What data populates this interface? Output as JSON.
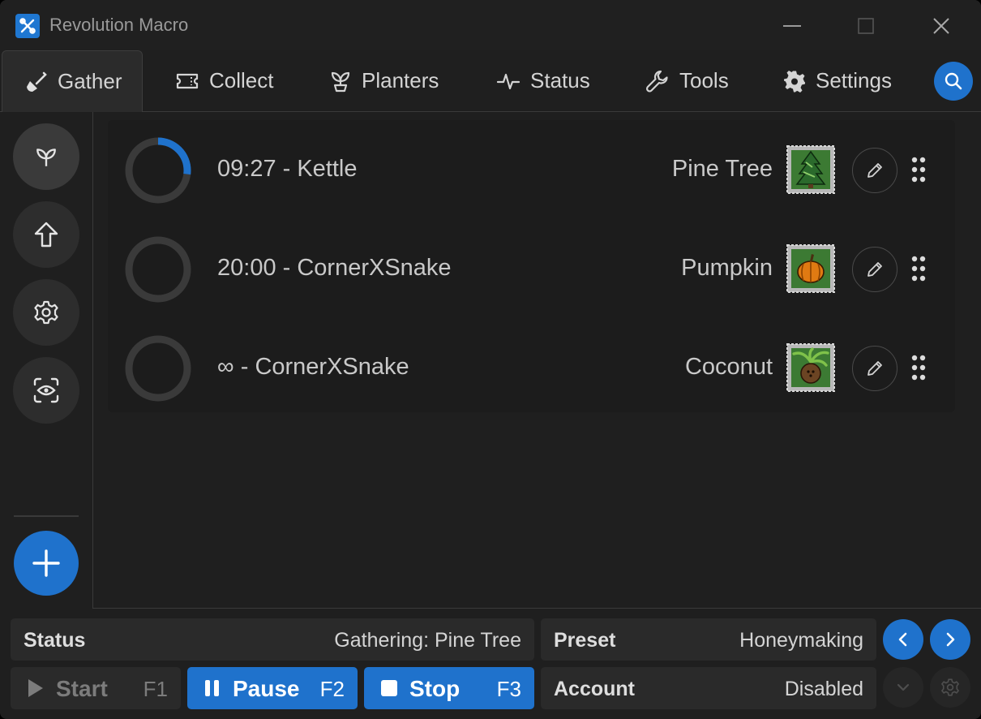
{
  "window": {
    "title": "Revolution Macro",
    "accent_color": "#1f72cc"
  },
  "tabs": [
    {
      "label": "Gather",
      "icon": "shovel-icon",
      "active": true
    },
    {
      "label": "Collect",
      "icon": "ticket-icon",
      "active": false
    },
    {
      "label": "Planters",
      "icon": "sprout-icon",
      "active": false
    },
    {
      "label": "Status",
      "icon": "pulse-icon",
      "active": false
    },
    {
      "label": "Tools",
      "icon": "wrench-icon",
      "active": false
    },
    {
      "label": "Settings",
      "icon": "gear-icon",
      "active": false
    }
  ],
  "sidebar": {
    "items": [
      {
        "icon": "sprout-icon",
        "active": true
      },
      {
        "icon": "arrow-up-icon",
        "active": false
      },
      {
        "icon": "gear-icon",
        "active": false
      },
      {
        "icon": "eye-scan-icon",
        "active": false
      }
    ],
    "add_icon": "plus-icon"
  },
  "gather_list": [
    {
      "text": "09:27 - Kettle",
      "field": "Pine Tree",
      "field_icon": "pine-tree-icon",
      "progress": 0.27
    },
    {
      "text": "20:00 - CornerXSnake",
      "field": "Pumpkin",
      "field_icon": "pumpkin-icon",
      "progress": 0
    },
    {
      "text": "∞ - CornerXSnake",
      "field": "Coconut",
      "field_icon": "coconut-icon",
      "progress": 0
    }
  ],
  "status_panel": {
    "label": "Status",
    "value": "Gathering: Pine Tree"
  },
  "preset_panel": {
    "label": "Preset",
    "value": "Honeymaking"
  },
  "account_panel": {
    "label": "Account",
    "value": "Disabled"
  },
  "controls": {
    "start": {
      "label": "Start",
      "key": "F1"
    },
    "pause": {
      "label": "Pause",
      "key": "F2"
    },
    "stop": {
      "label": "Stop",
      "key": "F3"
    }
  }
}
